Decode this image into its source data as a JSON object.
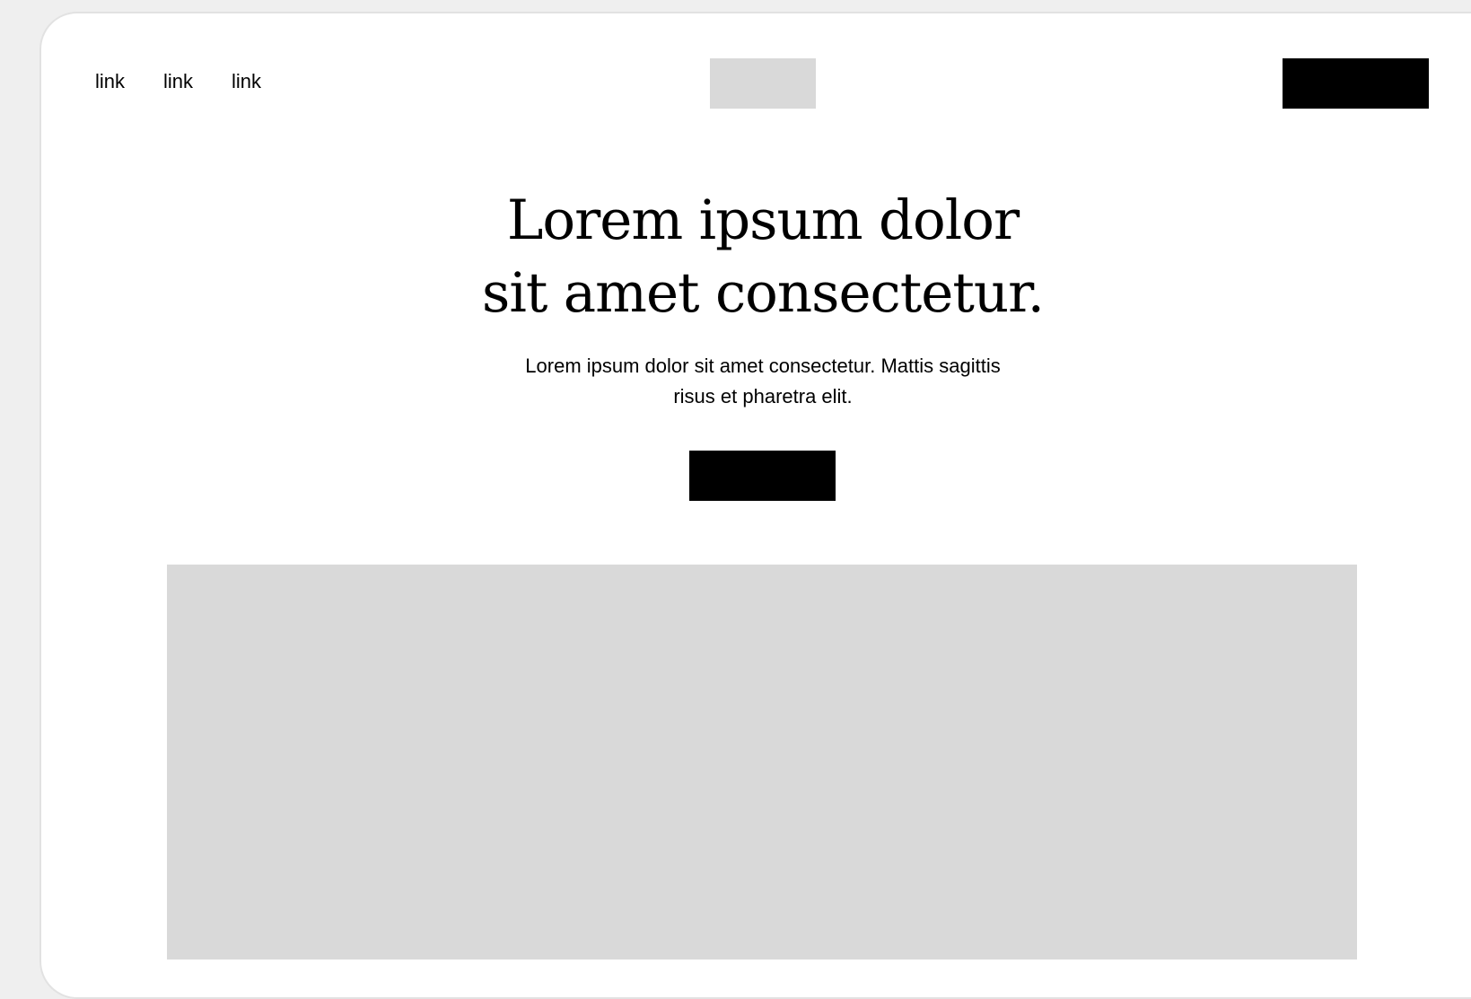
{
  "nav": {
    "links": [
      "link",
      "link",
      "link"
    ]
  },
  "header": {
    "logo_icon": "logo-placeholder",
    "cta_label": ""
  },
  "hero": {
    "title": "Lorem ipsum dolor sit amet consectetur.",
    "subtitle": "Lorem ipsum dolor sit amet consectetur. Mattis sagittis risus et pharetra elit.",
    "cta_label": "",
    "image_icon": "image-placeholder"
  },
  "colors": {
    "page_background": "#efefef",
    "frame_background": "#ffffff",
    "placeholder": "#d9d9d9",
    "button": "#000000",
    "text": "#000000"
  }
}
